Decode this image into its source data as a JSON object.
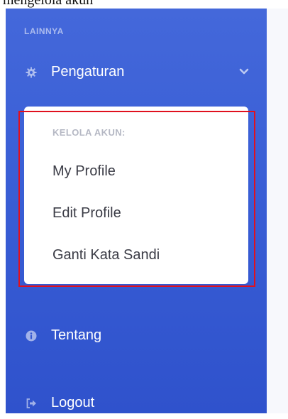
{
  "caption": "mengelola akun",
  "sidebar": {
    "section_heading": "LAINNYA",
    "settings": {
      "label": "Pengaturan",
      "icon": "gear-icon"
    },
    "submenu": {
      "heading": "KELOLA AKUN:",
      "items": [
        {
          "label": "My Profile"
        },
        {
          "label": "Edit Profile"
        },
        {
          "label": "Ganti Kata Sandi"
        }
      ]
    },
    "tentang": {
      "label": "Tentang",
      "icon": "info-circle-icon"
    },
    "logout": {
      "label": "Logout",
      "icon": "sign-out-icon"
    }
  },
  "colors": {
    "sidebar": "#3a5fd6",
    "highlight": "#e0101e",
    "submenu_bg": "#ffffff"
  }
}
